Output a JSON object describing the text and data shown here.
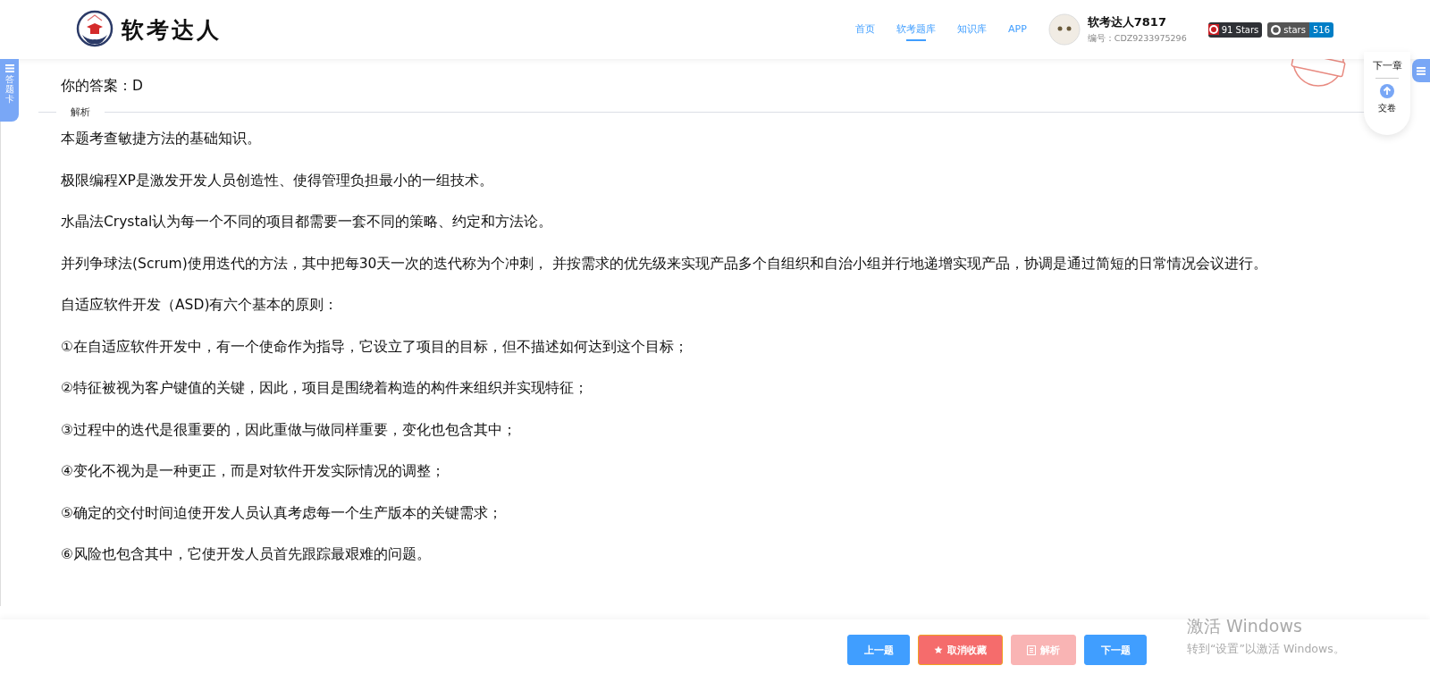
{
  "header": {
    "brand": "软考达人",
    "nav": [
      {
        "label": "首页",
        "selected": false
      },
      {
        "label": "软考题库",
        "selected": true
      },
      {
        "label": "知识库",
        "selected": false
      },
      {
        "label": "APP",
        "selected": false
      }
    ],
    "user": {
      "name": "软考达人7817",
      "id_label": "编号：CDZ9233975296"
    },
    "badges": [
      {
        "kind": "gitee",
        "label": "91 Stars"
      },
      {
        "kind": "github",
        "label": "stars",
        "count": "516"
      }
    ]
  },
  "side_tab": {
    "label": "答题卡"
  },
  "float_panel": {
    "next_chapter": "下一章",
    "submit": "交卷"
  },
  "answers": {
    "yours": "你的答案：D"
  },
  "analysis": {
    "title": "解析",
    "paragraphs": [
      "本题考查敏捷方法的基础知识。",
      "极限编程XP是激发开发人员创造性、使得管理负担最小的一组技术。",
      "水晶法Crystal认为每一个不同的项目都需要一套不同的策略、约定和方法论。",
      "并列争球法(Scrum)使用迭代的方法，其中把每30天一次的迭代称为个冲刺， 并按需求的优先级来实现产品多个自组织和自治小组并行地递增实现产品，协调是通过简短的日常情况会议进行。",
      "自适应软件开发（ASD)有六个基本的原则：",
      "①在自适应软件开发中，有一个使命作为指导，它设立了项目的目标，但不描述如何达到这个目标；",
      "②特征被视为客户键值的关键，因此，项目是围绕着构造的构件来组织并实现特征；",
      "③过程中的迭代是很重要的，因此重做与做同样重要，变化也包含其中；",
      "④变化不视为是一种更正，而是对软件开发实际情况的调整；",
      "⑤确定的交付时间迫使开发人员认真考虑每一个生产版本的关键需求；",
      "⑥风险也包含其中，它使开发人员首先跟踪最艰难的问题。"
    ]
  },
  "footer": {
    "buttons": [
      {
        "kind": "primary",
        "label": "上一题",
        "disabled": false
      },
      {
        "kind": "favorite",
        "label": "取消收藏",
        "disabled": false
      },
      {
        "kind": "analysis",
        "label": "解析",
        "disabled": true
      },
      {
        "kind": "primary",
        "label": "下一题",
        "disabled": false
      }
    ]
  },
  "os_notice": {
    "title": "激活 Windows",
    "subtitle": "转到“设置”以激活 Windows。"
  }
}
